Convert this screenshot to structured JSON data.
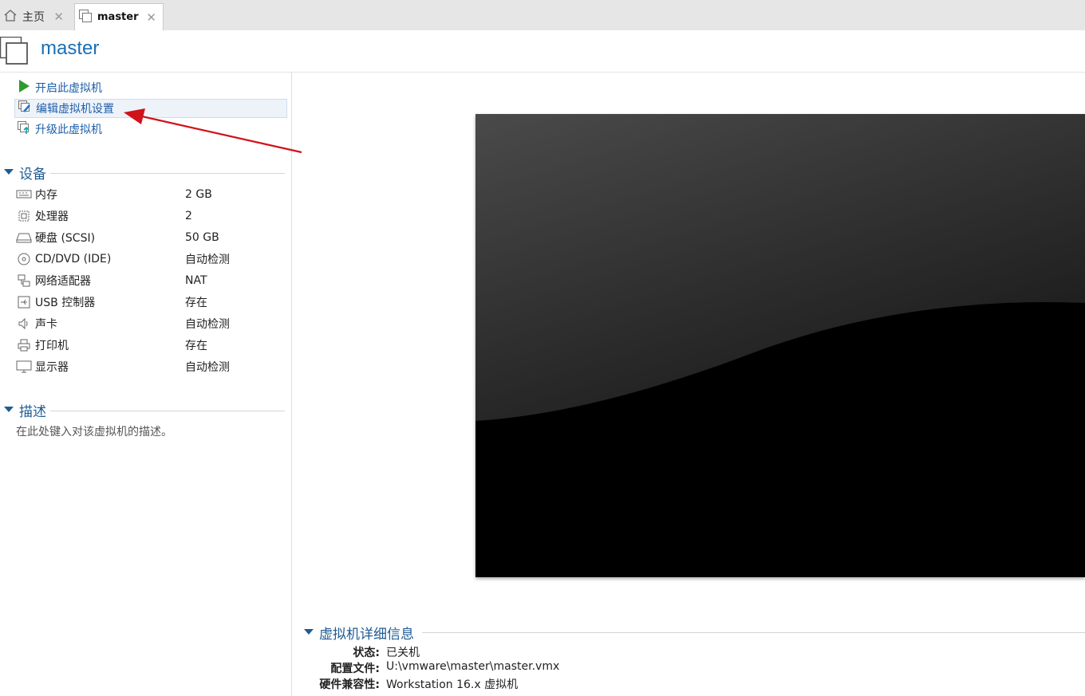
{
  "tabs": [
    {
      "label": "主页",
      "icon": "home-icon"
    },
    {
      "label": "master",
      "icon": "vm-icon"
    }
  ],
  "header": {
    "title": "master"
  },
  "actions": [
    {
      "label": "开启此虚拟机",
      "icon": "play-icon"
    },
    {
      "label": "编辑虚拟机设置",
      "icon": "edit-settings-icon"
    },
    {
      "label": "升级此虚拟机",
      "icon": "upgrade-icon"
    }
  ],
  "devices_section": {
    "title": "设备"
  },
  "devices": [
    {
      "name": "内存",
      "value": "2 GB",
      "icon": "memory-icon"
    },
    {
      "name": "处理器",
      "value": "2",
      "icon": "cpu-icon"
    },
    {
      "name": "硬盘 (SCSI)",
      "value": "50 GB",
      "icon": "harddisk-icon"
    },
    {
      "name": "CD/DVD (IDE)",
      "value": "自动检测",
      "icon": "cd-icon"
    },
    {
      "name": "网络适配器",
      "value": "NAT",
      "icon": "network-icon"
    },
    {
      "name": "USB 控制器",
      "value": "存在",
      "icon": "usb-icon"
    },
    {
      "name": "声卡",
      "value": "自动检测",
      "icon": "speaker-icon"
    },
    {
      "name": "打印机",
      "value": "存在",
      "icon": "printer-icon"
    },
    {
      "name": "显示器",
      "value": "自动检测",
      "icon": "monitor-icon"
    }
  ],
  "description_section": {
    "title": "描述",
    "placeholder": "在此处键入对该虚拟机的描述。"
  },
  "details": {
    "title": "虚拟机详细信息",
    "rows": [
      {
        "key": "状态:",
        "value": "已关机"
      },
      {
        "key": "配置文件:",
        "value": "U:\\vmware\\master\\master.vmx"
      },
      {
        "key": "硬件兼容性:",
        "value": "Workstation 16.x 虚拟机"
      }
    ]
  },
  "colors": {
    "accent": "#1a6fb6",
    "section": "#1f5c94",
    "annotation_arrow": "#d0121b"
  }
}
